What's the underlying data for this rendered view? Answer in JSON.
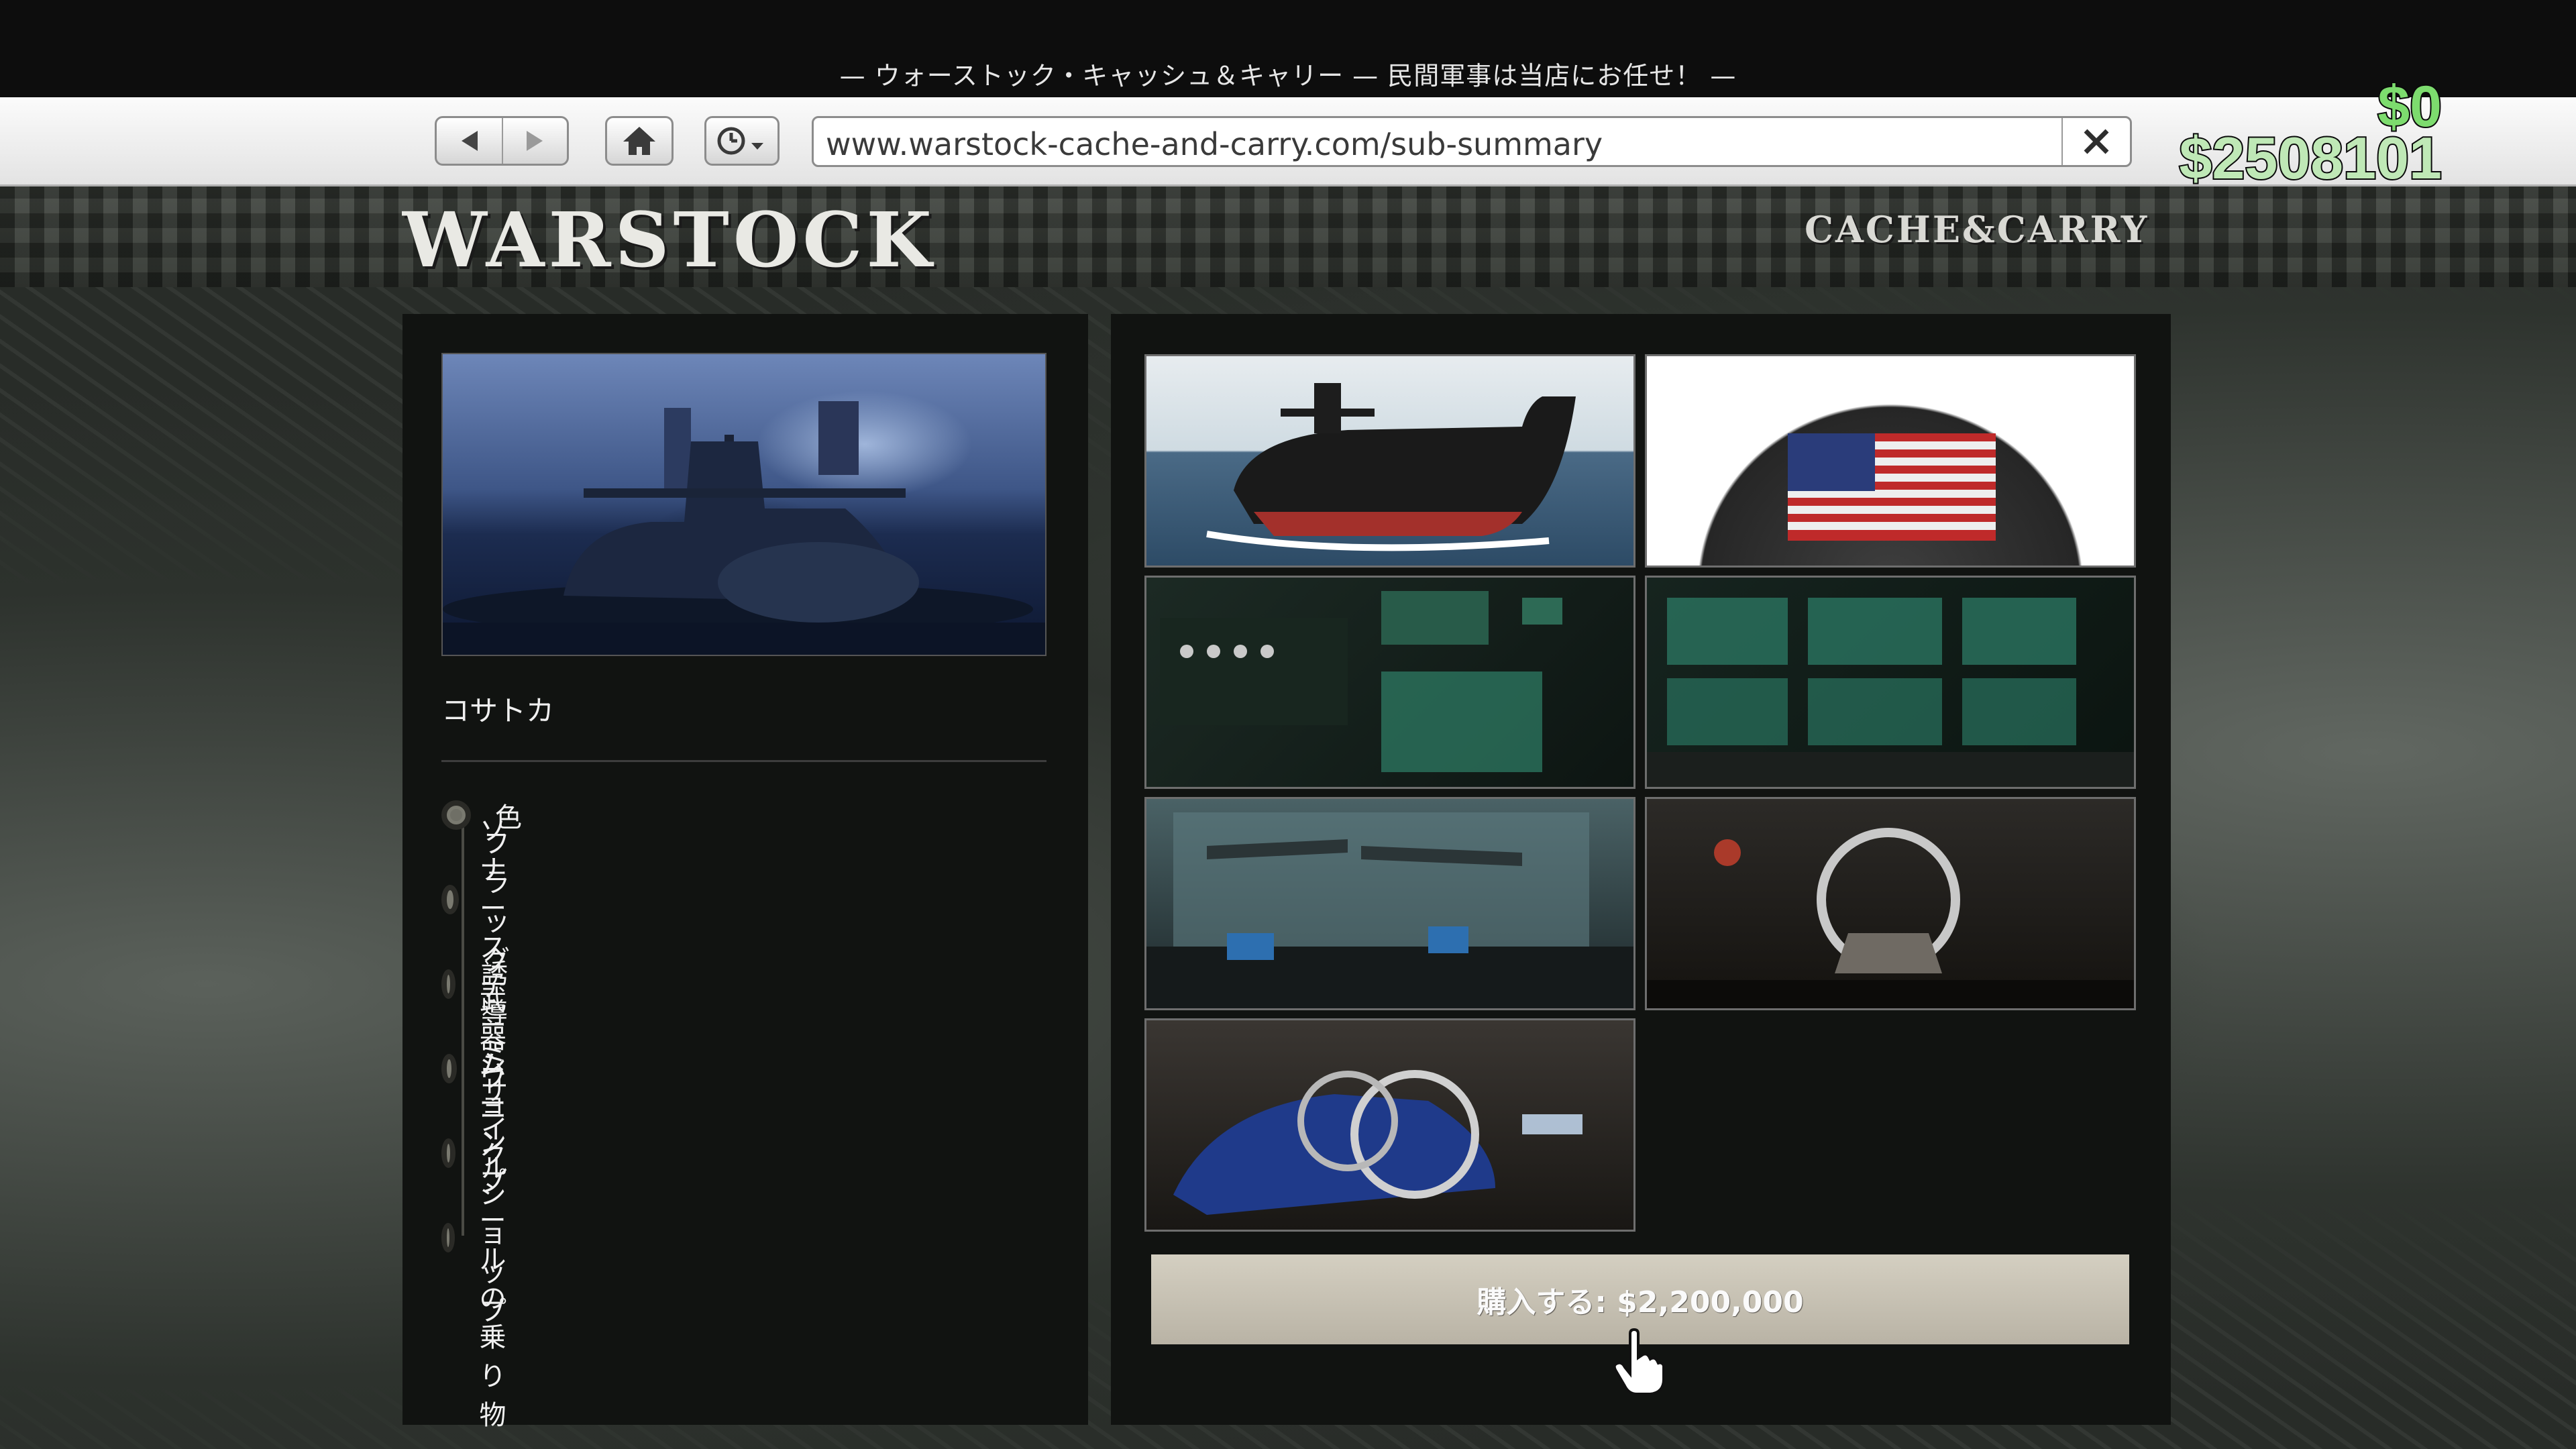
{
  "window": {
    "title": "— ウォーストック・キャッシュ＆キャリー — 民間軍事は当店にお任せ！ —"
  },
  "browser": {
    "url": "www.warstock-cache-and-carry.com/sub-summary",
    "back_icon": "arrow-left-icon",
    "forward_icon": "arrow-right-icon",
    "home_icon": "home-icon",
    "history_icon": "history-clock-icon",
    "close_icon": "close-icon"
  },
  "hud": {
    "cash": "$0",
    "bank": "$2508101",
    "cash_color": "#7ddc6e",
    "bank_color": "#bfe8b6"
  },
  "site": {
    "logo": "WARSTOCK",
    "tagline": "CACHE&CARRY"
  },
  "vehicle": {
    "name": "コサトカ",
    "options": [
      {
        "label": "色"
      },
      {
        "label": "フラッグ"
      },
      {
        "label": "ソナーステーション"
      },
      {
        "label": "誘導ミサイル"
      },
      {
        "label": "武器ワークショップ"
      },
      {
        "label": "ムーンプールの乗り物"
      }
    ]
  },
  "gallery": {
    "thumbnails": [
      {
        "name": "submarine-exterior"
      },
      {
        "name": "flag"
      },
      {
        "name": "sonar-station"
      },
      {
        "name": "guided-missile"
      },
      {
        "name": "weapon-workshop"
      },
      {
        "name": "helicopter-bay"
      },
      {
        "name": "moonpool-vehicle"
      }
    ]
  },
  "purchase": {
    "label": "購入する: $2,200,000",
    "button_color": "#c8c2b4"
  }
}
